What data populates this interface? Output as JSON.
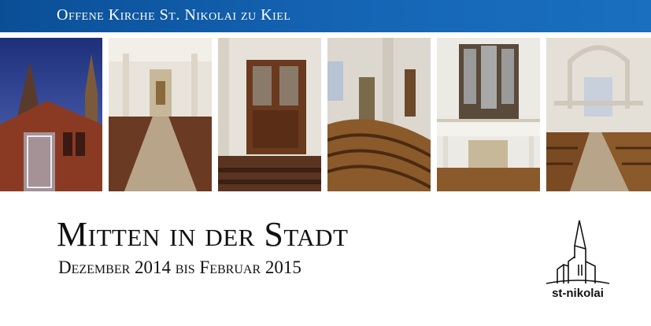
{
  "header": {
    "title": "Offene Kirche St. Nikolai zu Kiel",
    "background_color": "#1565b5"
  },
  "photos": [
    {
      "name": "church-exterior-night-photo"
    },
    {
      "name": "nave-toward-altar-photo"
    },
    {
      "name": "organ-wooden-case-photo"
    },
    {
      "name": "interior-curved-pews-photo"
    },
    {
      "name": "organ-gallery-photo"
    },
    {
      "name": "interior-upper-view-photo"
    }
  ],
  "main": {
    "title": "Mitten in der Stadt",
    "subtitle": "Dezember 2014 bis Februar 2015"
  },
  "logo": {
    "icon": "church-tower-logo-icon",
    "text": "st-nikolai"
  }
}
